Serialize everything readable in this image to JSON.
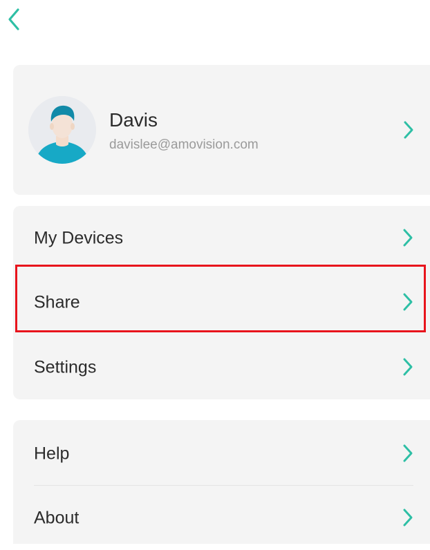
{
  "header": {
    "back_icon": "chevron-left-icon"
  },
  "profile": {
    "name": "Davis",
    "email": "davislee@amovision.com",
    "avatar_icon": "user-avatar-icon"
  },
  "menu_group_1": {
    "items": [
      {
        "label": "My Devices",
        "icon": "chevron-right-icon"
      },
      {
        "label": "Share",
        "icon": "chevron-right-icon",
        "highlighted": true
      },
      {
        "label": "Settings",
        "icon": "chevron-right-icon"
      }
    ]
  },
  "menu_group_2": {
    "items": [
      {
        "label": "Help",
        "icon": "chevron-right-icon"
      },
      {
        "label": "About",
        "icon": "chevron-right-icon"
      }
    ]
  },
  "colors": {
    "accent": "#2ebfa5",
    "card_background": "#f4f4f4",
    "highlight": "#e8141c",
    "avatar_shirt": "#17a9c6",
    "avatar_hair": "#128aa8"
  }
}
